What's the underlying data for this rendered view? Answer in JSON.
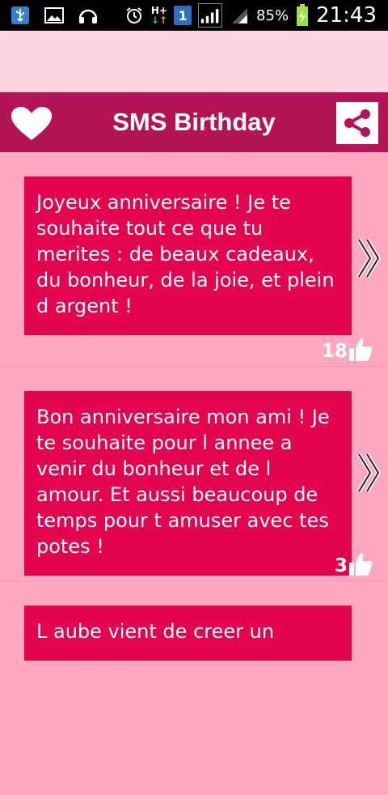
{
  "status_bar": {
    "left_icons": [
      "usb-icon",
      "image-icon",
      "headphones-icon"
    ],
    "right_icons": [
      "alarm-icon",
      "data-hplus-icon",
      "sim-1-icon",
      "signal-icon",
      "signal-icon-2",
      "battery-charging-icon"
    ],
    "network_label": "H+",
    "sim_label": "1",
    "battery_percent": "85%",
    "time": "21:43"
  },
  "app_bar": {
    "title": "SMS Birthday",
    "left_icon": "heart-icon",
    "right_icon": "share-icon"
  },
  "messages": [
    {
      "text": "Joyeux anniversaire ! Je te souhaite tout ce que tu merites : de beaux cadeaux, du bonheur, de la joie, et plein d argent !",
      "likes": "18"
    },
    {
      "text": "Bon anniversaire mon ami ! Je te souhaite pour l annee a venir du bonheur et de l amour. Et aussi beaucoup de temps pour t amuser avec tes potes !",
      "likes": "3"
    },
    {
      "text": "L aube vient de creer un",
      "likes": ""
    }
  ],
  "colors": {
    "background": "#ffa6c1",
    "ad_space": "#ffd4e2",
    "app_bar": "#b41358",
    "bubble": "#e4034e",
    "status_bar": "#000000"
  }
}
